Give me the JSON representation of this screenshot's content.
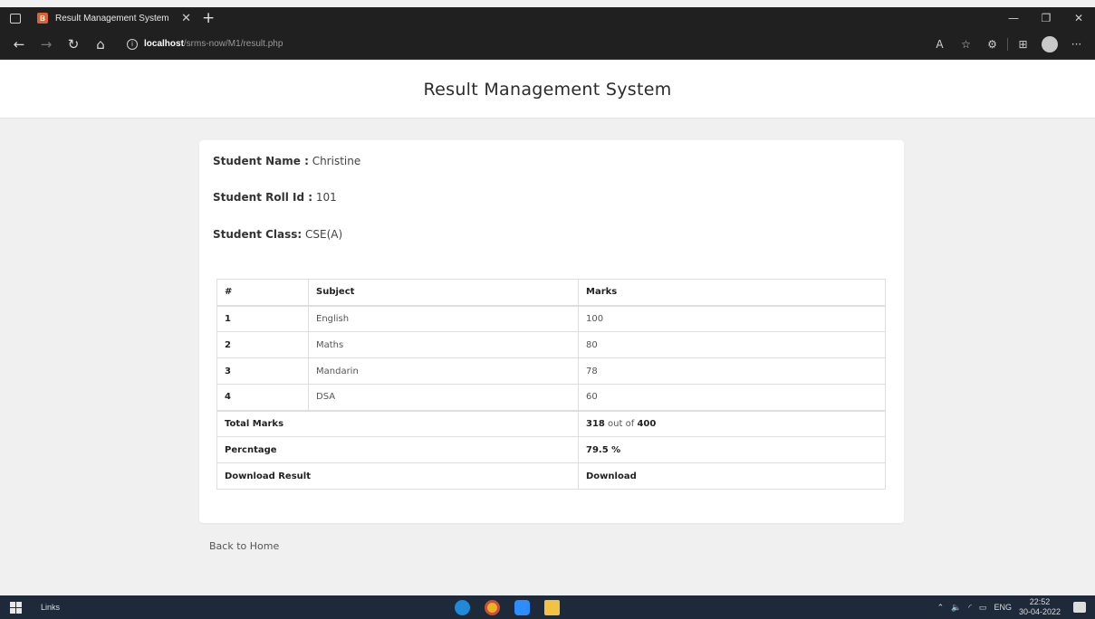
{
  "browser": {
    "tab_title": "Result Management System",
    "favicon_text": "B",
    "url_host": "localhost",
    "url_path": "/srms-now/M1/result.php"
  },
  "header": {
    "title": "Result Management System"
  },
  "student": {
    "name_label": "Student Name :",
    "name_value": " Christine",
    "roll_label": "Student Roll Id :",
    "roll_value": " 101",
    "class_label": "Student Class:",
    "class_value": " CSE(A)"
  },
  "table": {
    "headers": [
      "#",
      "Subject",
      "Marks"
    ],
    "rows": [
      {
        "num": "1",
        "subject": "English",
        "marks": "100"
      },
      {
        "num": "2",
        "subject": "Maths",
        "marks": "80"
      },
      {
        "num": "3",
        "subject": "Mandarin",
        "marks": "78"
      },
      {
        "num": "4",
        "subject": "DSA",
        "marks": "60"
      }
    ],
    "total_label": "Total Marks",
    "total_obtained": "318",
    "total_out_of": " out of ",
    "total_max": "400",
    "percentage_label": "Percntage",
    "percentage_value": "79.5 %",
    "download_label": "Download Result",
    "download_link": "Download"
  },
  "footer": {
    "back_link": "Back to Home"
  },
  "taskbar": {
    "links_label": "Links",
    "lang": "ENG",
    "time": "22:52",
    "date": "30-04-2022"
  }
}
